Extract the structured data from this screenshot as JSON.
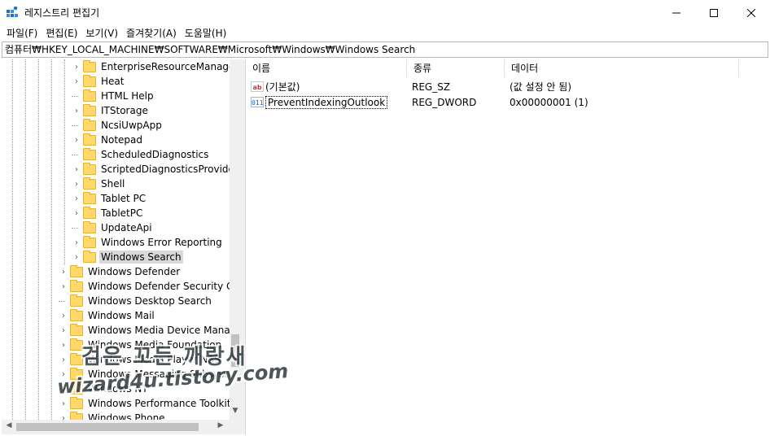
{
  "window": {
    "title": "레지스트리 편집기",
    "minimize_glyph": "—",
    "maximize_glyph": "☐",
    "close_glyph": "✕"
  },
  "menu": [
    "파일(F)",
    "편집(E)",
    "보기(V)",
    "즐겨찾기(A)",
    "도움말(H)"
  ],
  "address": "컴퓨터₩HKEY_LOCAL_MACHINE₩SOFTWARE₩Microsoft₩Windows₩Windows Search",
  "tree": {
    "items": [
      {
        "label": "EnterpriseResourceManager",
        "expandable": true
      },
      {
        "label": "Heat",
        "expandable": true
      },
      {
        "label": "HTML Help",
        "expandable": false
      },
      {
        "label": "ITStorage",
        "expandable": true
      },
      {
        "label": "NcsiUwpApp",
        "expandable": false
      },
      {
        "label": "Notepad",
        "expandable": true
      },
      {
        "label": "ScheduledDiagnostics",
        "expandable": false
      },
      {
        "label": "ScriptedDiagnosticsProvider",
        "expandable": true
      },
      {
        "label": "Shell",
        "expandable": true
      },
      {
        "label": "Tablet PC",
        "expandable": true
      },
      {
        "label": "TabletPC",
        "expandable": true
      },
      {
        "label": "UpdateApi",
        "expandable": false
      },
      {
        "label": "Windows Error Reporting",
        "expandable": true
      },
      {
        "label": "Windows Search",
        "expandable": true,
        "selected": true
      },
      {
        "label": "Windows Defender",
        "expandable": true
      },
      {
        "label": "Windows Defender Security Cer",
        "expandable": true
      },
      {
        "label": "Windows Desktop Search",
        "expandable": false
      },
      {
        "label": "Windows Mail",
        "expandable": true
      },
      {
        "label": "Windows Media Device Manage",
        "expandable": true
      },
      {
        "label": "Windows Media Foundation",
        "expandable": true
      },
      {
        "label": "Windows Media Player NSS",
        "expandable": true
      },
      {
        "label": "Windows Messaging Subsystem",
        "expandable": true
      },
      {
        "label": "Windows NT",
        "expandable": true
      },
      {
        "label": "Windows Performance Toolkit",
        "expandable": true
      },
      {
        "label": "Windows Phone",
        "expandable": true
      }
    ]
  },
  "list": {
    "columns": {
      "name": "이름",
      "type": "종류",
      "data": "데이터"
    },
    "rows": [
      {
        "name": "(기본값)",
        "type": "REG_SZ",
        "data": "(값 설정 안 됨)",
        "icon": "ab"
      },
      {
        "name": "PreventIndexingOutlook",
        "type": "REG_DWORD",
        "data": "0x00000001 (1)",
        "icon": "011"
      }
    ]
  },
  "watermark": {
    "line1": "검은 꼬든 깨랑새",
    "line2": "wizard4u.tistory.com"
  },
  "colors": {
    "folder": "#ffd86a",
    "selection": "#d9d9d9",
    "scrollbar": "#f0f0f0"
  }
}
